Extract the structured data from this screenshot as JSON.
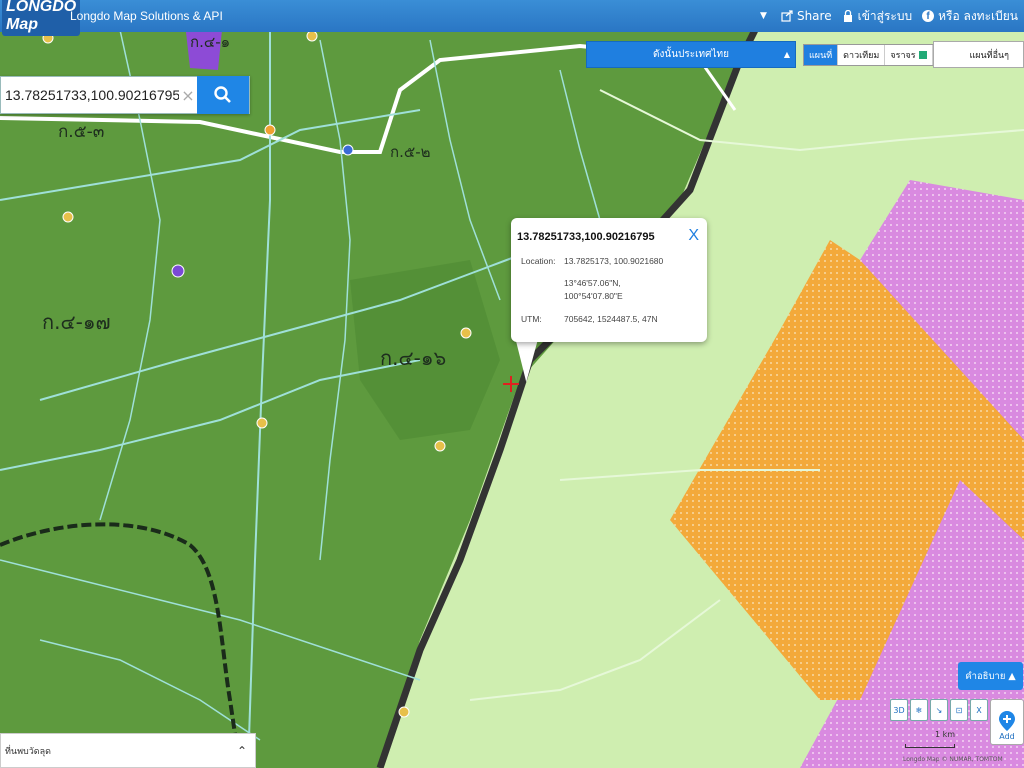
{
  "topbar": {
    "logo": "LONGDO Map",
    "title": "Longdo Map Solutions & API",
    "share": "Share",
    "login": "เข้าสู่ระบบ",
    "register": "หรือ ลงทะเบียน"
  },
  "search": {
    "value": "13.78251733,100.90216795",
    "clear_icon": "×"
  },
  "province_select": "ดังนั้นประเทศไทย",
  "map_types": [
    {
      "label": "แผนที่",
      "active": true
    },
    {
      "label": "ดาวเทียม",
      "active": false
    },
    {
      "label": "จราจร",
      "active": false
    }
  ],
  "layer_select": "แผนที่อื่นๆ",
  "popup": {
    "title": "13.78251733,100.90216795",
    "location_label": "Location:",
    "location_dec": "13.7825173, 100.9021680",
    "location_dms_1": "13°46'57.06\"N,",
    "location_dms_2": "100°54'07.80\"E",
    "utm_label": "UTM:",
    "utm_value": "705642, 1524487.5, 47N",
    "close_icon": "X"
  },
  "map_labels": {
    "k5": "ก.๕-๓",
    "k4_17": "ก.๔-๑๗",
    "k4_16": "ก.๔-๑๖",
    "k_top": "ก.๕-๒",
    "k_top2": "ก.๔-๑"
  },
  "bottom_left": "ที่นพบวัดลุด",
  "legend_button": "คำอธิบาย",
  "tools": [
    "3D",
    "❄",
    "↘",
    "⊡",
    "X"
  ],
  "add_button": "Add",
  "scale": "1 km",
  "attribution": "Longdo Map © NUMAR, TOMTOM",
  "colors": {
    "dark_green": "#5e9a3e",
    "light_green": "#cfeeb0",
    "orange": "#f3a93a",
    "magenta": "#d98ae0",
    "accent_blue": "#1f86e6"
  }
}
